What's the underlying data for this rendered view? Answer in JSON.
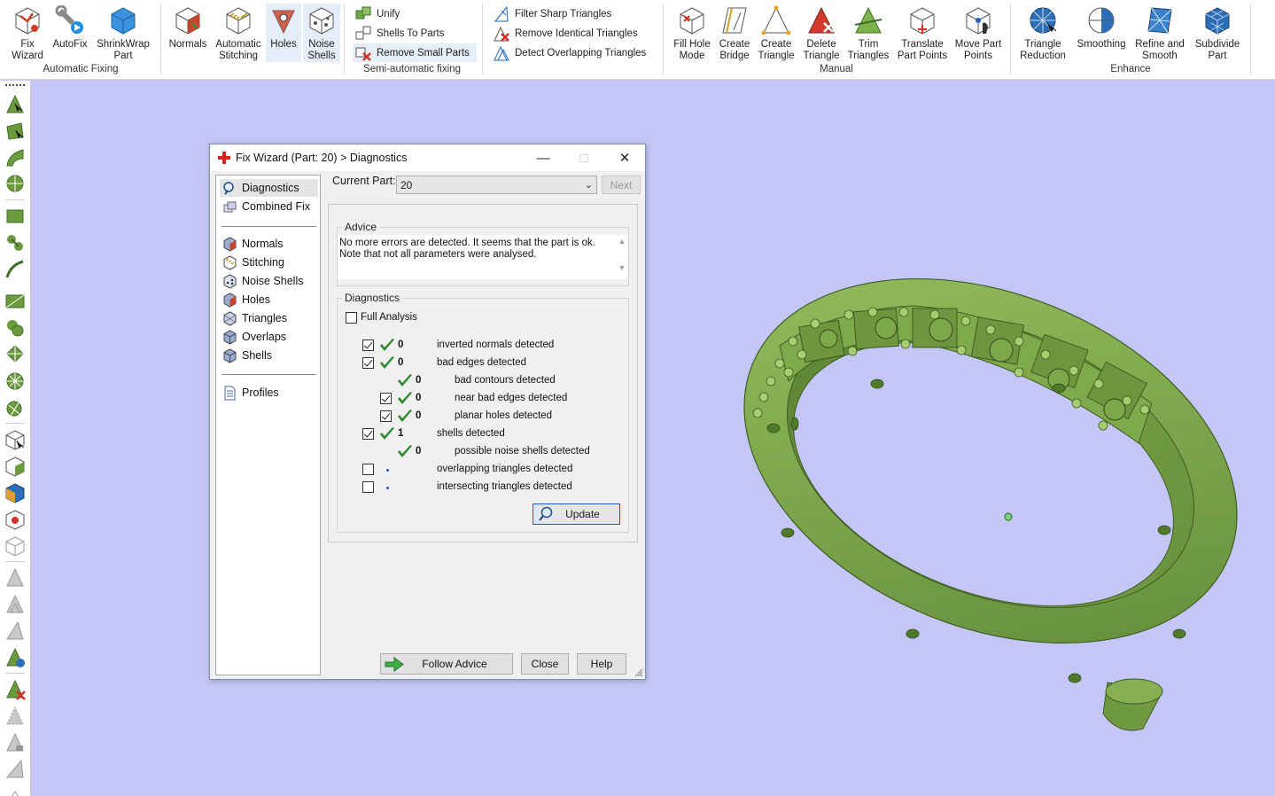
{
  "ribbon": {
    "groups": [
      {
        "title": "Automatic Fixing",
        "buttons": [
          {
            "label": "Fix\nWizard",
            "icon": "fix-wizard-icon"
          },
          {
            "label": "AutoFix",
            "icon": "autofix-icon"
          },
          {
            "label": "ShrinkWrap\nPart",
            "icon": "shrinkwrap-icon"
          }
        ]
      },
      {
        "title": "Semi-automatic fixing",
        "buttons": [
          {
            "label": "Normals",
            "icon": "normals-icon"
          },
          {
            "label": "Automatic\nStitching",
            "icon": "stitching-icon"
          },
          {
            "label": "Holes",
            "icon": "holes-icon"
          },
          {
            "label": "Noise\nShells",
            "icon": "noise-shells-icon"
          }
        ],
        "small": [
          {
            "label": "Unify",
            "icon": "unify-icon"
          },
          {
            "label": "Shells To Parts",
            "icon": "shells-to-parts-icon"
          },
          {
            "label": "Remove Small Parts",
            "icon": "remove-small-parts-icon"
          },
          {
            "label": "Filter Sharp Triangles",
            "icon": "filter-sharp-triangles-icon"
          },
          {
            "label": "Remove Identical Triangles",
            "icon": "remove-identical-triangles-icon"
          },
          {
            "label": "Detect Overlapping Triangles",
            "icon": "detect-overlapping-triangles-icon"
          }
        ]
      },
      {
        "title": "Manual",
        "buttons": [
          {
            "label": "Fill Hole\nMode",
            "icon": "fill-hole-icon"
          },
          {
            "label": "Create\nBridge",
            "icon": "create-bridge-icon"
          },
          {
            "label": "Create\nTriangle",
            "icon": "create-triangle-icon"
          },
          {
            "label": "Delete\nTriangle",
            "icon": "delete-triangle-icon"
          },
          {
            "label": "Trim\nTriangles",
            "icon": "trim-triangles-icon"
          },
          {
            "label": "Translate\nPart Points",
            "icon": "translate-points-icon"
          },
          {
            "label": "Move Part\nPoints",
            "icon": "move-points-icon"
          }
        ]
      },
      {
        "title": "Enhance",
        "buttons": [
          {
            "label": "Triangle\nReduction",
            "icon": "triangle-reduction-icon"
          },
          {
            "label": "Smoothing",
            "icon": "smoothing-icon"
          },
          {
            "label": "Refine and\nSmooth",
            "icon": "refine-smooth-icon"
          },
          {
            "label": "Subdivide\nPart",
            "icon": "subdivide-icon"
          }
        ]
      }
    ]
  },
  "dialog": {
    "title": "Fix Wizard (Part: 20) > Diagnostics",
    "nav": [
      {
        "label": "Diagnostics",
        "icon": "diagnostics-icon"
      },
      {
        "label": "Combined Fix",
        "icon": "combined-fix-icon"
      },
      {
        "label": "Normals",
        "icon": "normals-icon"
      },
      {
        "label": "Stitching",
        "icon": "stitching-icon"
      },
      {
        "label": "Noise Shells",
        "icon": "noise-shells-icon"
      },
      {
        "label": "Holes",
        "icon": "holes-icon"
      },
      {
        "label": "Triangles",
        "icon": "triangles-icon"
      },
      {
        "label": "Overlaps",
        "icon": "overlaps-icon"
      },
      {
        "label": "Shells",
        "icon": "shells-icon"
      },
      {
        "label": "Profiles",
        "icon": "profiles-icon"
      }
    ],
    "current_part_label": "Current Part:",
    "current_part_value": "20",
    "next_label": "Next",
    "advice_legend": "Advice",
    "advice_line1": "No more errors are detected. It seems that the part is ok.",
    "advice_line2": "Note that not all parameters were analysed.",
    "diagnostics_legend": "Diagnostics",
    "full_analysis_label": "Full Analysis",
    "rows": [
      {
        "checked": true,
        "count": "0",
        "text": "inverted normals detected",
        "indent": 0
      },
      {
        "checked": true,
        "count": "0",
        "text": "bad edges detected",
        "indent": 0
      },
      {
        "checked": null,
        "count": "0",
        "text": "bad contours detected",
        "indent": 1
      },
      {
        "checked": true,
        "count": "0",
        "text": "near bad edges detected",
        "indent": 1
      },
      {
        "checked": true,
        "count": "0",
        "text": "planar holes detected",
        "indent": 1
      },
      {
        "checked": true,
        "count": "1",
        "text": "shells detected",
        "indent": 0
      },
      {
        "checked": null,
        "count": "0",
        "text": "possible noise shells detected",
        "indent": 1
      },
      {
        "checked": false,
        "count": "",
        "text": "overlapping triangles detected",
        "indent": 0
      },
      {
        "checked": false,
        "count": "",
        "text": "intersecting triangles detected",
        "indent": 0
      }
    ],
    "update_label": "Update",
    "follow_advice_label": "Follow Advice",
    "close_label": "Close",
    "help_label": "Help"
  },
  "colors": {
    "viewport": "#c6c6f6",
    "model_green": "#7fa650",
    "check_green": "#2f8a2f",
    "accent_blue": "#0f63c8"
  }
}
